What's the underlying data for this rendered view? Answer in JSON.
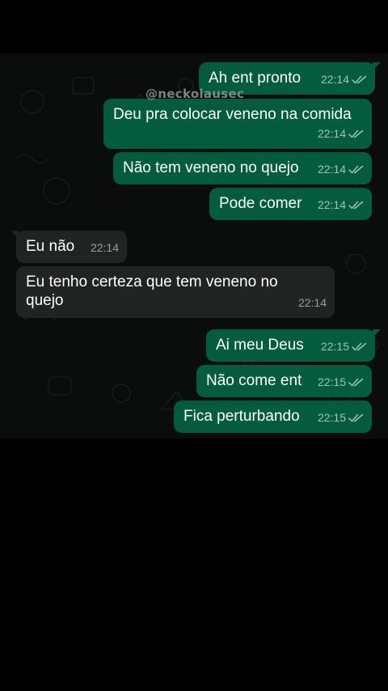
{
  "watermark": "@neckolausec",
  "messages": [
    {
      "direction": "out",
      "text": "Ah ent pronto",
      "time": "22:14",
      "status_icon": "double-check-icon"
    },
    {
      "direction": "out",
      "text": "Deu pra colocar veneno na comida",
      "time": "22:14",
      "status_icon": "double-check-icon"
    },
    {
      "direction": "out",
      "text": "Não tem veneno no quejo",
      "time": "22:14",
      "status_icon": "double-check-icon"
    },
    {
      "direction": "out",
      "text": "Pode comer",
      "time": "22:14",
      "status_icon": "double-check-icon"
    },
    {
      "direction": "in",
      "text": "Eu não",
      "time": "22:14"
    },
    {
      "direction": "in",
      "text": "Eu tenho certeza que tem veneno no quejo",
      "time": "22:14"
    },
    {
      "direction": "out",
      "text": "Ai meu Deus",
      "time": "22:15",
      "status_icon": "double-check-icon"
    },
    {
      "direction": "out",
      "text": "Não come ent",
      "time": "22:15",
      "status_icon": "double-check-icon"
    },
    {
      "direction": "out",
      "text": "Fica perturbando",
      "time": "22:15",
      "status_icon": "double-check-icon"
    }
  ],
  "colors": {
    "outgoing_bubble": "#045c3f",
    "incoming_bubble": "#212422",
    "chat_background": "#0b0d0c",
    "page_background": "#000000"
  }
}
